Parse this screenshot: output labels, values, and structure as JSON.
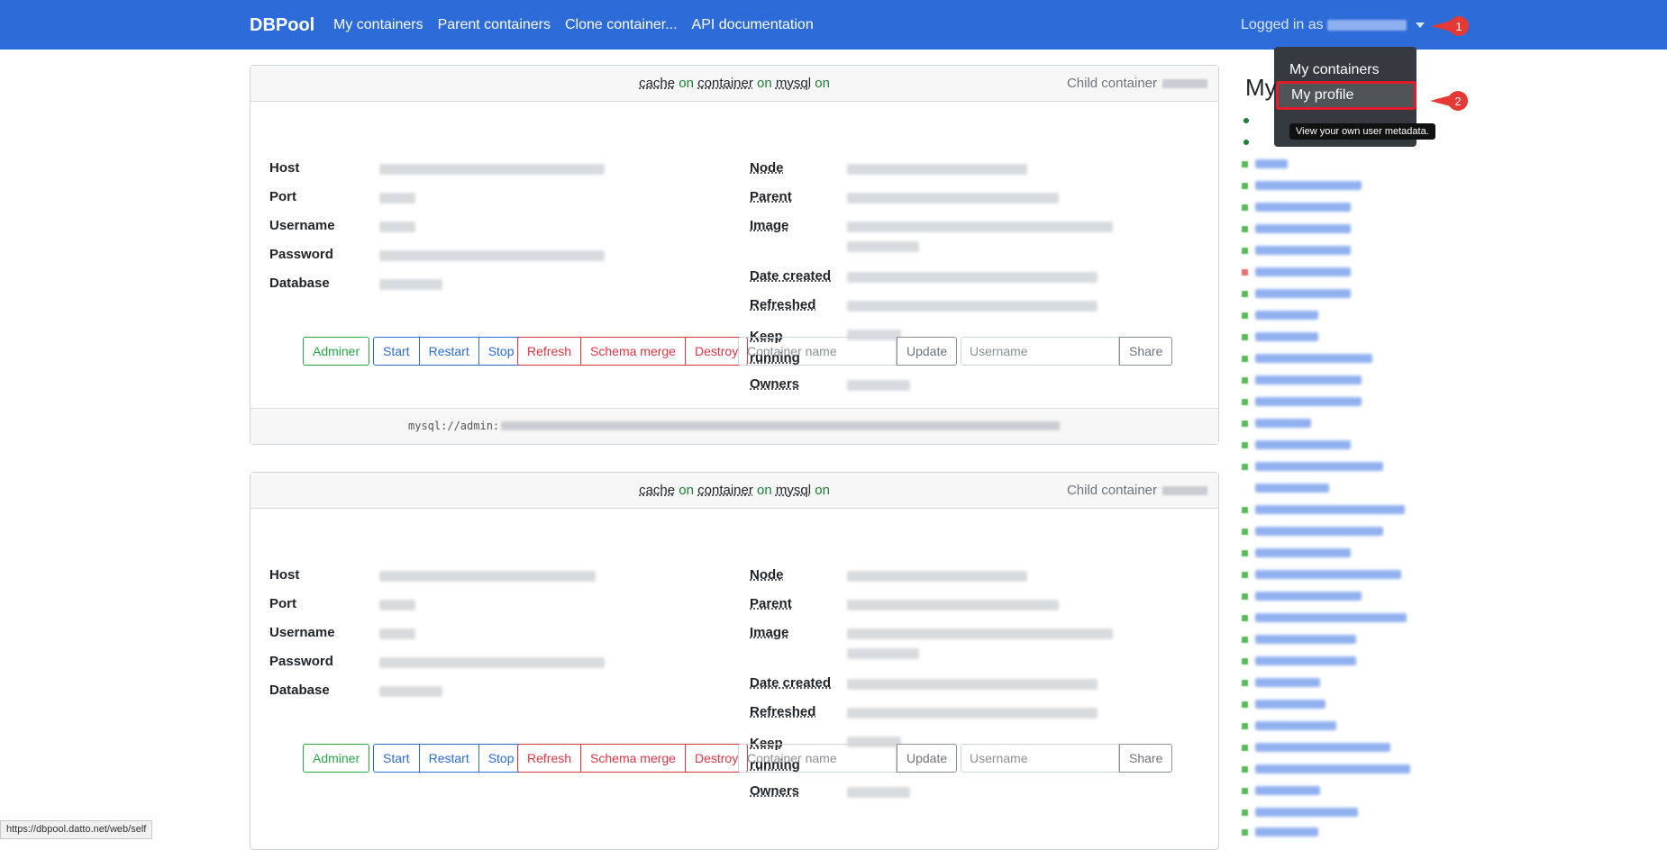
{
  "navbar": {
    "brand": "DBPool",
    "links": [
      "My containers",
      "Parent containers",
      "Clone container...",
      "API documentation"
    ],
    "logged_in_label": "Logged in as",
    "accent_color": "#2d6bd8"
  },
  "markers": [
    "1",
    "2"
  ],
  "user_menu": {
    "items": [
      "My containers",
      "My profile"
    ],
    "active_item": "My profile",
    "tooltip": "View your own user metadata."
  },
  "containers": [
    {
      "tags": [
        "cache",
        "on",
        "container",
        "on",
        "mysql",
        "on"
      ],
      "child_label": "Child container",
      "fields_left": [
        "Host",
        "Port",
        "Username",
        "Password",
        "Database"
      ],
      "fields_right": [
        "Node",
        "Parent",
        "Image",
        "Date created",
        "Refreshed",
        "Keep running",
        "Owners"
      ],
      "buttons": {
        "adminer": "Adminer",
        "start": "Start",
        "restart": "Restart",
        "stop": "Stop",
        "refresh": "Refresh",
        "schema_merge": "Schema merge",
        "destroy": "Destroy",
        "update": "Update",
        "share": "Share"
      },
      "container_name_placeholder": "Container name",
      "username_placeholder": "Username",
      "connection_prefix": "mysql://admin:"
    },
    {
      "tags": [
        "cache",
        "on",
        "container",
        "on",
        "mysql",
        "on"
      ],
      "child_label": "Child container",
      "fields_left": [
        "Host",
        "Port",
        "Username",
        "Password",
        "Database"
      ],
      "fields_right": [
        "Node",
        "Parent",
        "Image",
        "Date created",
        "Refreshed",
        "Keep running",
        "Owners"
      ],
      "buttons": {
        "adminer": "Adminer",
        "start": "Start",
        "restart": "Restart",
        "stop": "Stop",
        "refresh": "Refresh",
        "schema_merge": "Schema merge",
        "destroy": "Destroy",
        "update": "Update",
        "share": "Share"
      },
      "container_name_placeholder": "Container name",
      "username_placeholder": "Username"
    }
  ],
  "sidebar": {
    "title": "My"
  },
  "status_url": "https://dbpool.datto.net/web/self"
}
